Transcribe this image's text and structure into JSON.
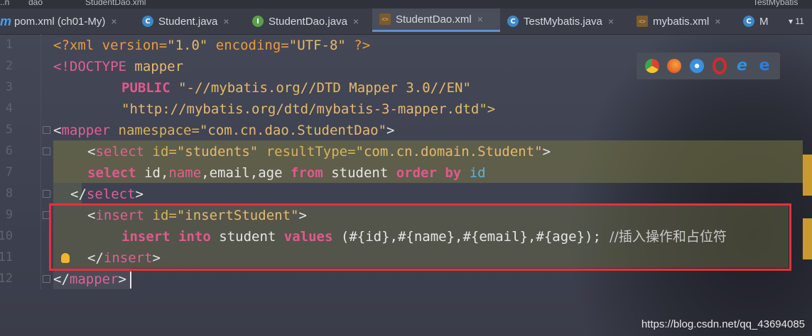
{
  "breadcrumb": {
    "items": [
      "..n",
      "dao",
      "StudentDao.xml"
    ],
    "right": "TestMybatis"
  },
  "tabs": [
    {
      "label": "pom.xml (ch01-My)",
      "icon": "maven-icon",
      "active": false
    },
    {
      "label": "Student.java",
      "icon": "class-icon",
      "active": false
    },
    {
      "label": "StudentDao.java",
      "icon": "interface-icon",
      "active": false
    },
    {
      "label": "StudentDao.xml",
      "icon": "xml-icon",
      "active": true
    },
    {
      "label": "TestMybatis.java",
      "icon": "class-icon",
      "active": false
    },
    {
      "label": "mybatis.xml",
      "icon": "xml-icon",
      "active": false
    },
    {
      "label": "M",
      "icon": "class-icon",
      "active": false
    }
  ],
  "tab_overflow": "▾ 11",
  "line_numbers": [
    "1",
    "2",
    "3",
    "4",
    "5",
    "6",
    "7",
    "8",
    "9",
    "10",
    "11",
    "12"
  ],
  "code": {
    "l1": {
      "a": "<?xml version=",
      "b": "\"1.0\"",
      "c": " encoding=",
      "d": "\"UTF-8\"",
      "e": " ?>"
    },
    "l2": {
      "a": "<!DOCTYPE ",
      "b": "mapper"
    },
    "l3": {
      "a": "PUBLIC ",
      "b": "\"-//mybatis.org//DTD Mapper 3.0//EN\""
    },
    "l4": {
      "a": "\"http://mybatis.org/dtd/mybatis-3-mapper.dtd\">"
    },
    "l5": {
      "a": "<",
      "b": "mapper",
      "c": " namespace=",
      "d": "\"com.cn.dao.StudentDao\"",
      "e": ">"
    },
    "l6": {
      "a": "<",
      "b": "select",
      "c": " id=",
      "d": "\"students\"",
      "e": " resultType=",
      "f": "\"com.cn.domain.Student\"",
      "g": ">"
    },
    "l7": {
      "a": "select",
      "b": " id,",
      "c": "name",
      "d": ",email,age ",
      "e": "from",
      "f": " student ",
      "g": "order by",
      "h": " id"
    },
    "l8": {
      "a": "</",
      "b": "select",
      "c": ">"
    },
    "l9": {
      "a": "<",
      "b": "insert",
      "c": " id=",
      "d": "\"insertStudent\"",
      "e": ">"
    },
    "l10": {
      "a": "insert",
      "b": " into",
      "c": " student ",
      "d": "values",
      "e": " (#{id},#{name},#{email},#{age});",
      "f": "  //插入操作和占位符"
    },
    "l11": {
      "a": "</",
      "b": "insert",
      "c": ">"
    },
    "l12": {
      "a": "</",
      "b": "mapper",
      "c": ">"
    }
  },
  "browser_icons": [
    {
      "name": "chrome-icon",
      "color": "#e0402f"
    },
    {
      "name": "firefox-icon",
      "color": "#e8742a"
    },
    {
      "name": "safari-icon",
      "color": "#3a8fe0"
    },
    {
      "name": "opera-icon",
      "color": "#d42a2a"
    },
    {
      "name": "ie-icon",
      "color": "#2f8fe0"
    },
    {
      "name": "edge-icon",
      "color": "#2a7ee0"
    }
  ],
  "watermark": "https://blog.csdn.net/qq_43694085",
  "colors": {
    "annotation_box": "#e8303a",
    "active_tab_underline": "#5d8fd8"
  }
}
